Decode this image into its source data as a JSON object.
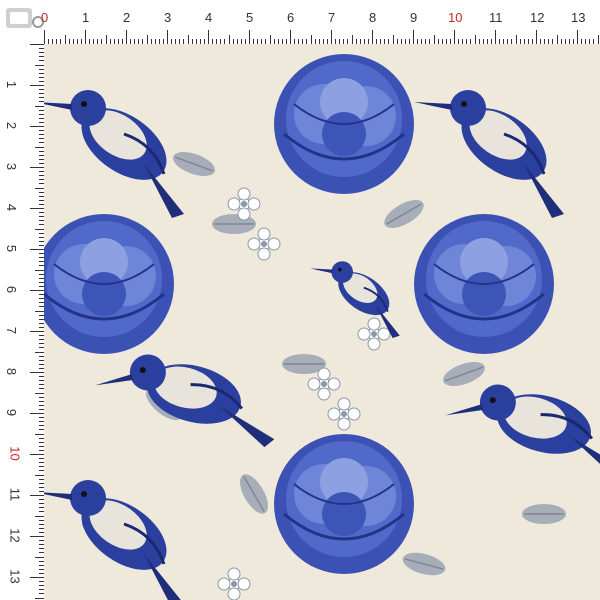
{
  "ruler": {
    "top_labels": [
      "0",
      "1",
      "2",
      "3",
      "4",
      "5",
      "6",
      "7",
      "8",
      "9",
      "10",
      "11",
      "12",
      "13"
    ],
    "left_labels": [
      "1",
      "2",
      "3",
      "4",
      "5",
      "6",
      "7",
      "8",
      "9",
      "10",
      "11",
      "12",
      "13"
    ],
    "highlight_label": "10",
    "origin_label": "0",
    "highlight_color": "#c62828"
  },
  "pattern": {
    "background_color": "#efe9dc",
    "primary_color": "#2b3f9e",
    "secondary_color": "#8d96a6",
    "motifs": [
      "bird",
      "peony",
      "leaf",
      "blossom"
    ]
  }
}
